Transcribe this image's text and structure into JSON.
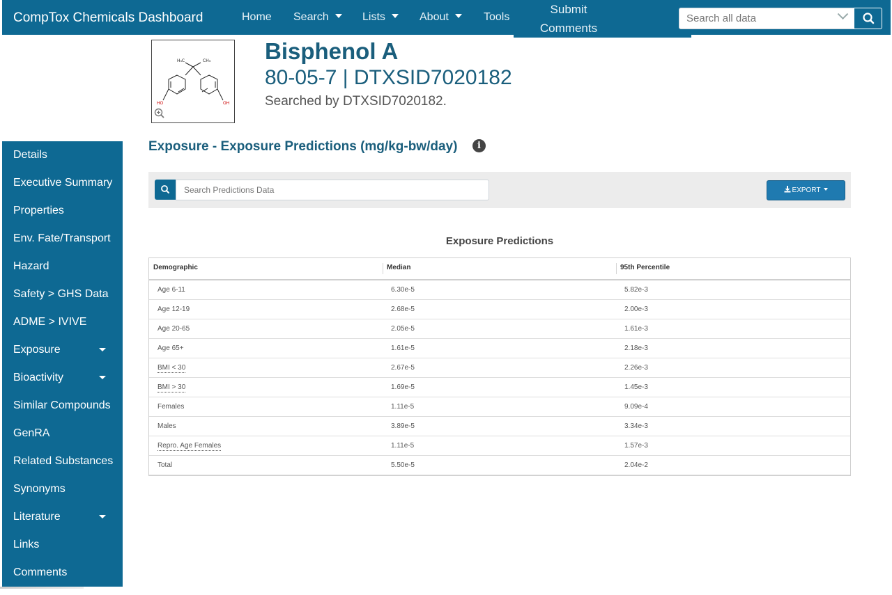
{
  "navbar": {
    "brand": "CompTox Chemicals Dashboard",
    "items": [
      {
        "label": "Home",
        "dropdown": false
      },
      {
        "label": "Search",
        "dropdown": true
      },
      {
        "label": "Lists",
        "dropdown": true
      },
      {
        "label": "About",
        "dropdown": true
      },
      {
        "label": "Tools",
        "dropdown": true
      }
    ],
    "submit_line1": "Submit",
    "submit_line2": "Comments",
    "search_placeholder": "Search all data"
  },
  "compound": {
    "name": "Bisphenol A",
    "ids": "80-05-7 | DTXSID7020182",
    "searched_by": "Searched by DTXSID7020182."
  },
  "sidebar": {
    "items": [
      {
        "label": "Details",
        "expandable": false
      },
      {
        "label": "Executive Summary",
        "expandable": false
      },
      {
        "label": "Properties",
        "expandable": false
      },
      {
        "label": "Env. Fate/Transport",
        "expandable": false
      },
      {
        "label": "Hazard",
        "expandable": false
      },
      {
        "label": "Safety > GHS Data",
        "expandable": false
      },
      {
        "label": "ADME > IVIVE",
        "expandable": false
      },
      {
        "label": "Exposure",
        "expandable": true
      },
      {
        "label": "Bioactivity",
        "expandable": true
      },
      {
        "label": "Similar Compounds",
        "expandable": false
      },
      {
        "label": "GenRA",
        "expandable": false
      },
      {
        "label": "Related Substances",
        "expandable": false
      },
      {
        "label": "Synonyms",
        "expandable": false
      },
      {
        "label": "Literature",
        "expandable": true
      },
      {
        "label": "Links",
        "expandable": false
      },
      {
        "label": "Comments",
        "expandable": false
      }
    ]
  },
  "section": {
    "title": "Exposure - Exposure Predictions (mg/kg-bw/day)",
    "search_placeholder": "Search Predictions Data",
    "export_label": "EXPORT",
    "table_title": "Exposure Predictions"
  },
  "table": {
    "columns": [
      "Demographic",
      "Median",
      "95th Percentile"
    ],
    "rows": [
      {
        "demographic": "Age 6-11",
        "median": "6.30e-5",
        "p95": "5.82e-3",
        "abbr": false
      },
      {
        "demographic": "Age 12-19",
        "median": "2.68e-5",
        "p95": "2.00e-3",
        "abbr": false
      },
      {
        "demographic": "Age 20-65",
        "median": "2.05e-5",
        "p95": "1.61e-3",
        "abbr": false
      },
      {
        "demographic": "Age 65+",
        "median": "1.61e-5",
        "p95": "2.18e-3",
        "abbr": false
      },
      {
        "demographic": "BMI < 30",
        "median": "2.67e-5",
        "p95": "2.26e-3",
        "abbr": true
      },
      {
        "demographic": "BMI > 30",
        "median": "1.69e-5",
        "p95": "1.45e-3",
        "abbr": true
      },
      {
        "demographic": "Females",
        "median": "1.11e-5",
        "p95": "9.09e-4",
        "abbr": false
      },
      {
        "demographic": "Males",
        "median": "3.89e-5",
        "p95": "3.34e-3",
        "abbr": false
      },
      {
        "demographic": "Repro. Age Females",
        "median": "1.11e-5",
        "p95": "1.57e-3",
        "abbr": true
      },
      {
        "demographic": "Total",
        "median": "5.50e-5",
        "p95": "2.04e-2",
        "abbr": false
      }
    ]
  },
  "colors": {
    "brand_blue": "#0e6993",
    "title_blue": "#1a5e7c"
  }
}
